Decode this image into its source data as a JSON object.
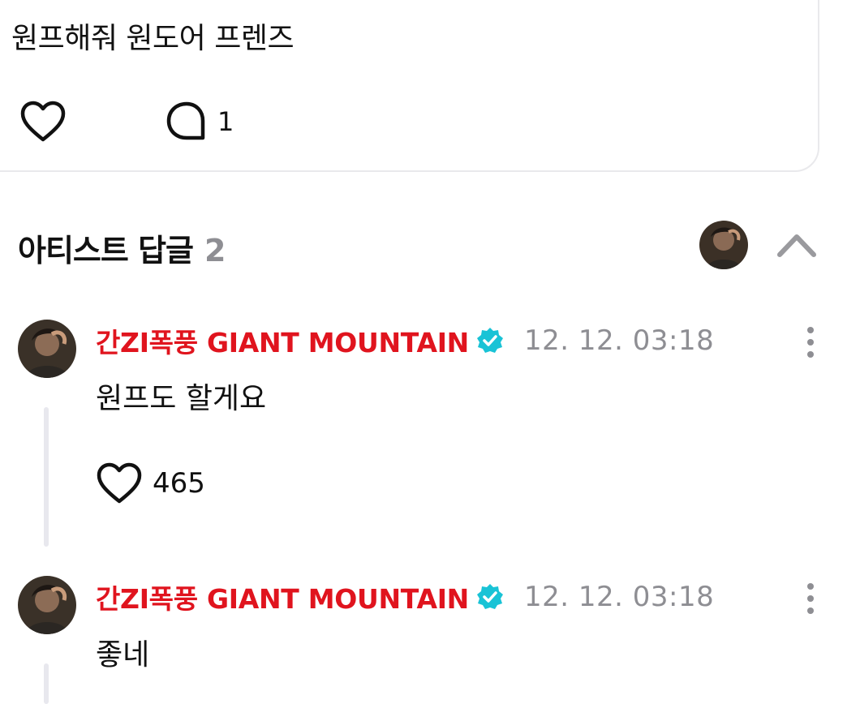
{
  "post": {
    "text": "원프해줘 원도어 프렌즈",
    "like_icon": "heart-outline-icon",
    "comment_icon": "speech-bubble-icon",
    "comment_count": "1"
  },
  "artist_replies": {
    "title": "아티스트 답글",
    "count": "2",
    "collapse_icon": "chevron-up-icon"
  },
  "replies": [
    {
      "author": "간ZI폭풍 GIANT MOUNTAIN",
      "verified": true,
      "time": "12. 12. 03:18",
      "text": "원프도 할게요",
      "like_count": "465"
    },
    {
      "author": "간ZI폭풍 GIANT MOUNTAIN",
      "verified": true,
      "time": "12. 12. 03:18",
      "text": "좋네"
    }
  ],
  "colors": {
    "author": "#e0141e",
    "verified_badge": "#19c3d6",
    "muted": "#8e8e93",
    "border": "#e9e9ec"
  }
}
